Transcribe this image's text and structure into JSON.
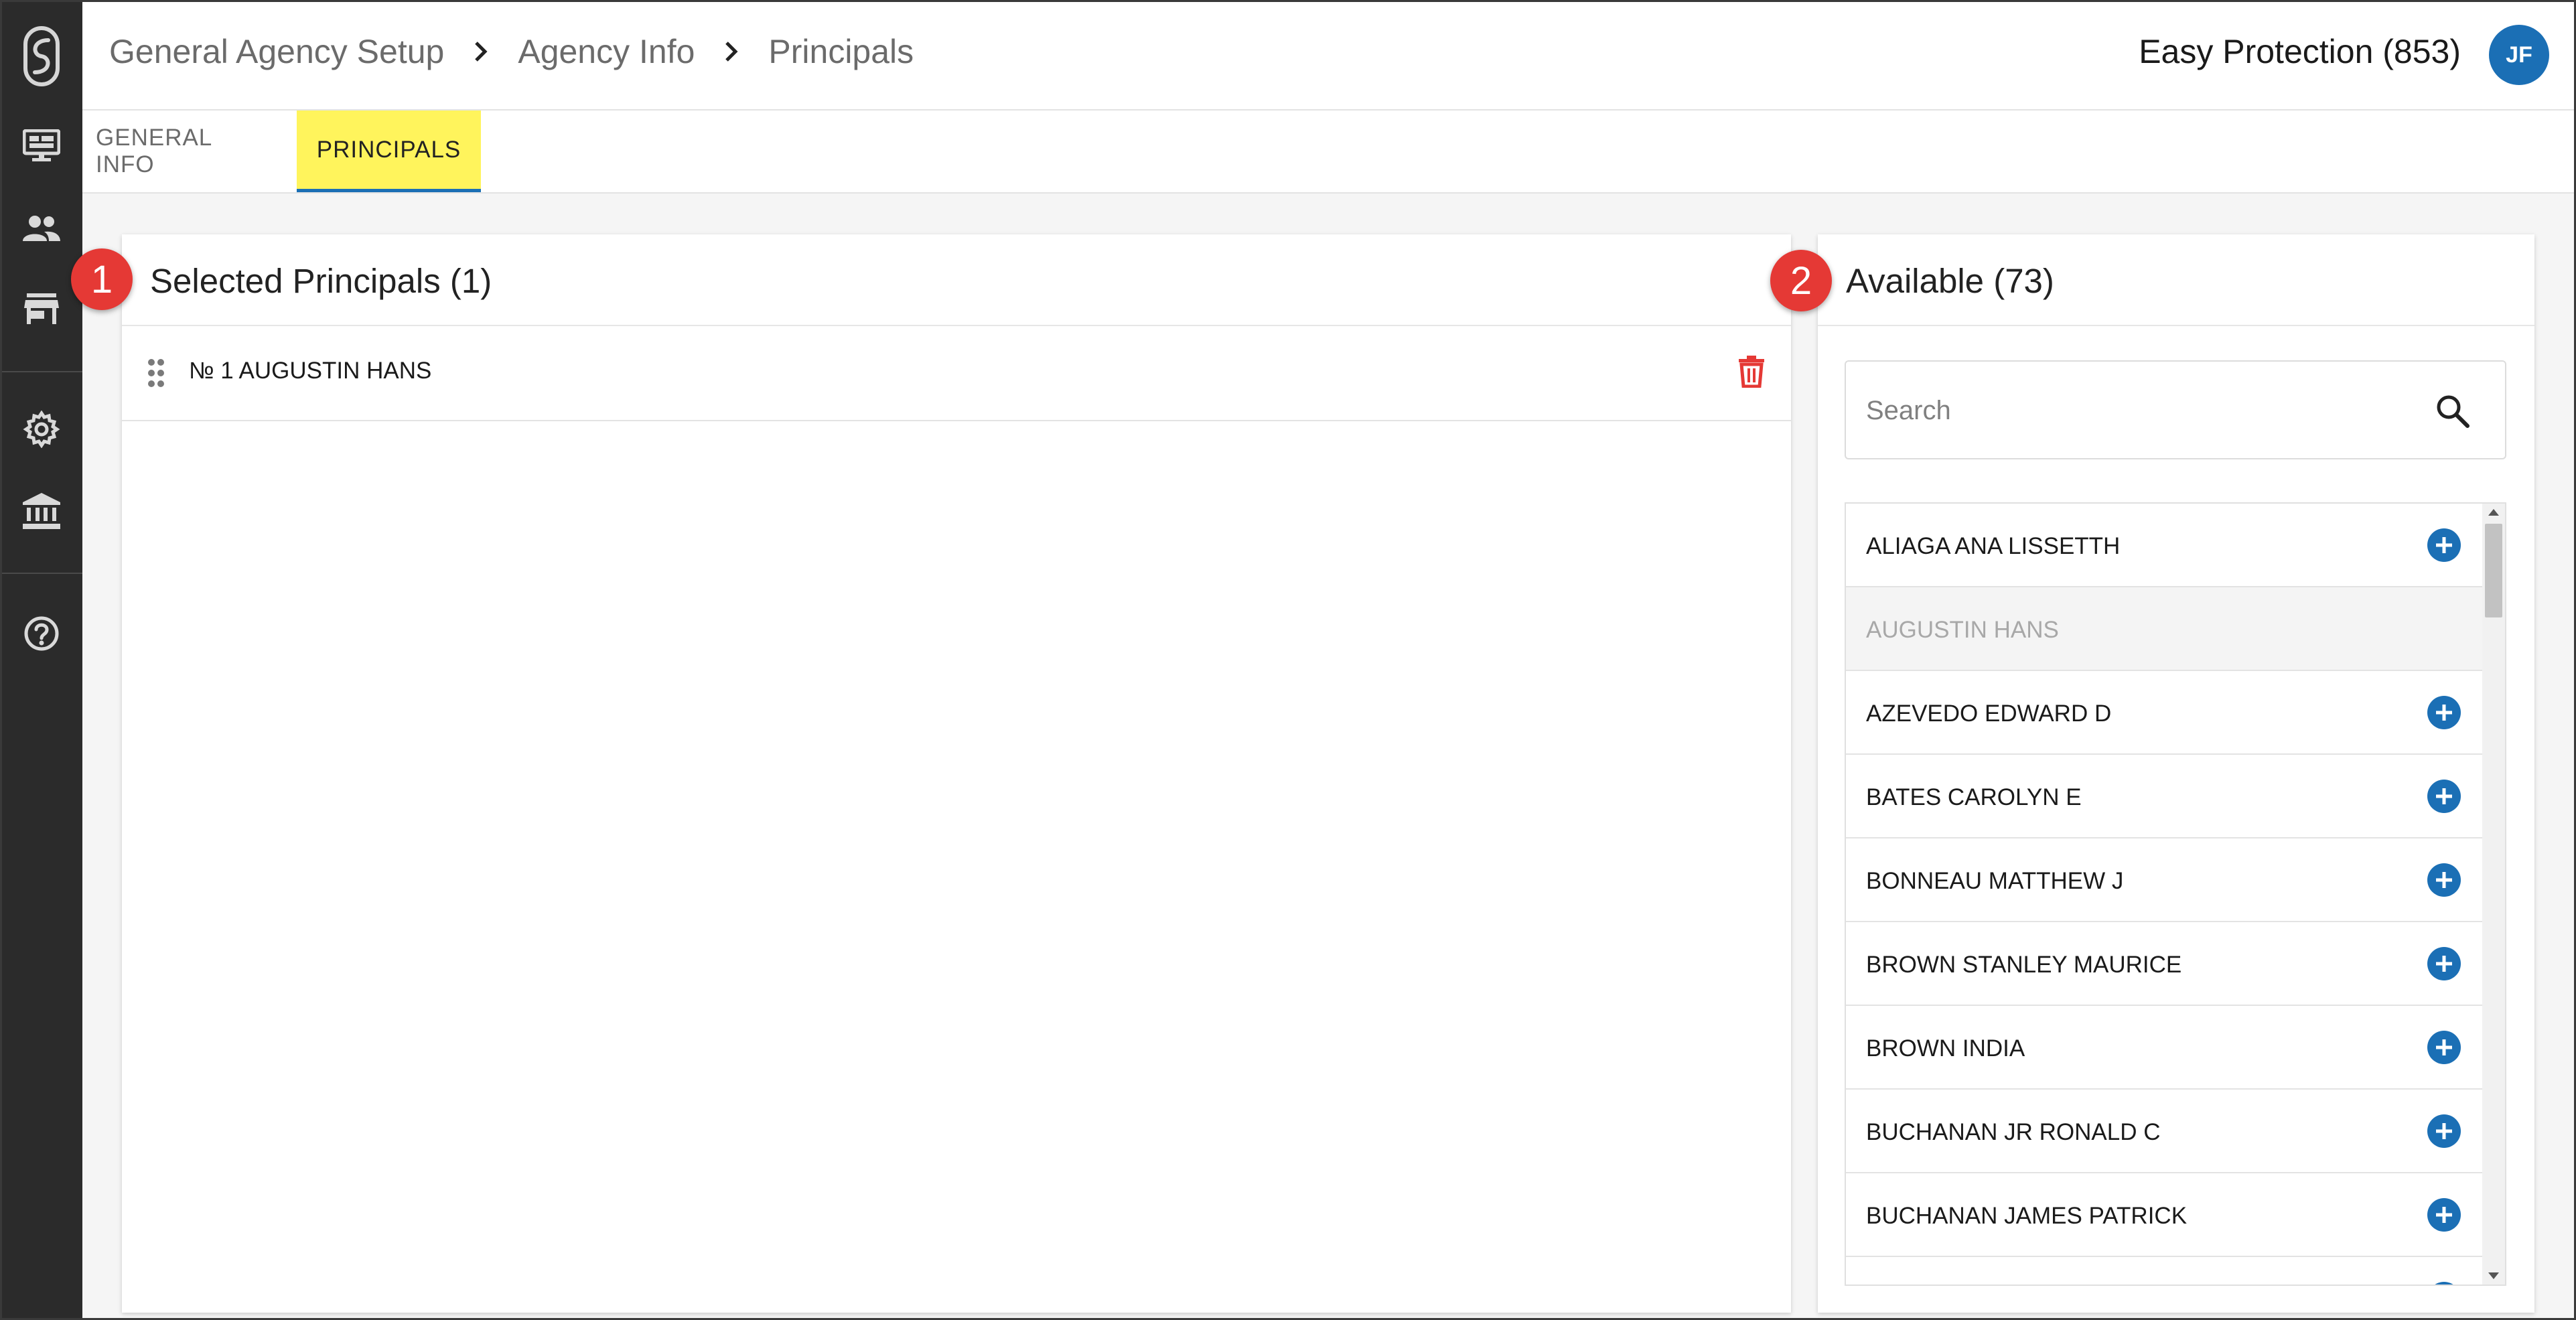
{
  "sidebar": {
    "logo": "app-logo",
    "items": [
      {
        "icon": "dashboard-icon"
      },
      {
        "icon": "people-icon"
      },
      {
        "icon": "store-icon"
      },
      {
        "icon": "settings-icon"
      },
      {
        "icon": "bank-icon"
      },
      {
        "icon": "help-icon"
      }
    ]
  },
  "header": {
    "breadcrumbs": [
      "General Agency Setup",
      "Agency Info",
      "Principals"
    ],
    "company": "Easy Protection (853)",
    "avatar_initials": "JF"
  },
  "tabs": {
    "general": "GENERAL INFO",
    "principals": "PRINCIPALS",
    "active": "PRINCIPALS"
  },
  "badges": {
    "one": "1",
    "two": "2"
  },
  "selected_panel": {
    "title": "Selected Principals (1)",
    "items": [
      {
        "label": "№ 1 AUGUSTIN HANS"
      }
    ]
  },
  "available_panel": {
    "title": "Available (73)",
    "search_placeholder": "Search",
    "items": [
      {
        "label": "ALIAGA ANA LISSETTH",
        "disabled": false
      },
      {
        "label": "AUGUSTIN HANS",
        "disabled": true
      },
      {
        "label": "AZEVEDO EDWARD D",
        "disabled": false
      },
      {
        "label": "BATES CAROLYN E",
        "disabled": false
      },
      {
        "label": "BONNEAU MATTHEW J",
        "disabled": false
      },
      {
        "label": "BROWN STANLEY MAURICE",
        "disabled": false
      },
      {
        "label": "BROWN INDIA",
        "disabled": false
      },
      {
        "label": "BUCHANAN JR RONALD C",
        "disabled": false
      },
      {
        "label": "BUCHANAN JAMES PATRICK",
        "disabled": false
      }
    ]
  },
  "colors": {
    "sidebar": "#2b2b2b",
    "accent": "#1b6fb5",
    "active_tab_bg": "#fff45c",
    "badge": "#e53935",
    "delete": "#e53935"
  }
}
